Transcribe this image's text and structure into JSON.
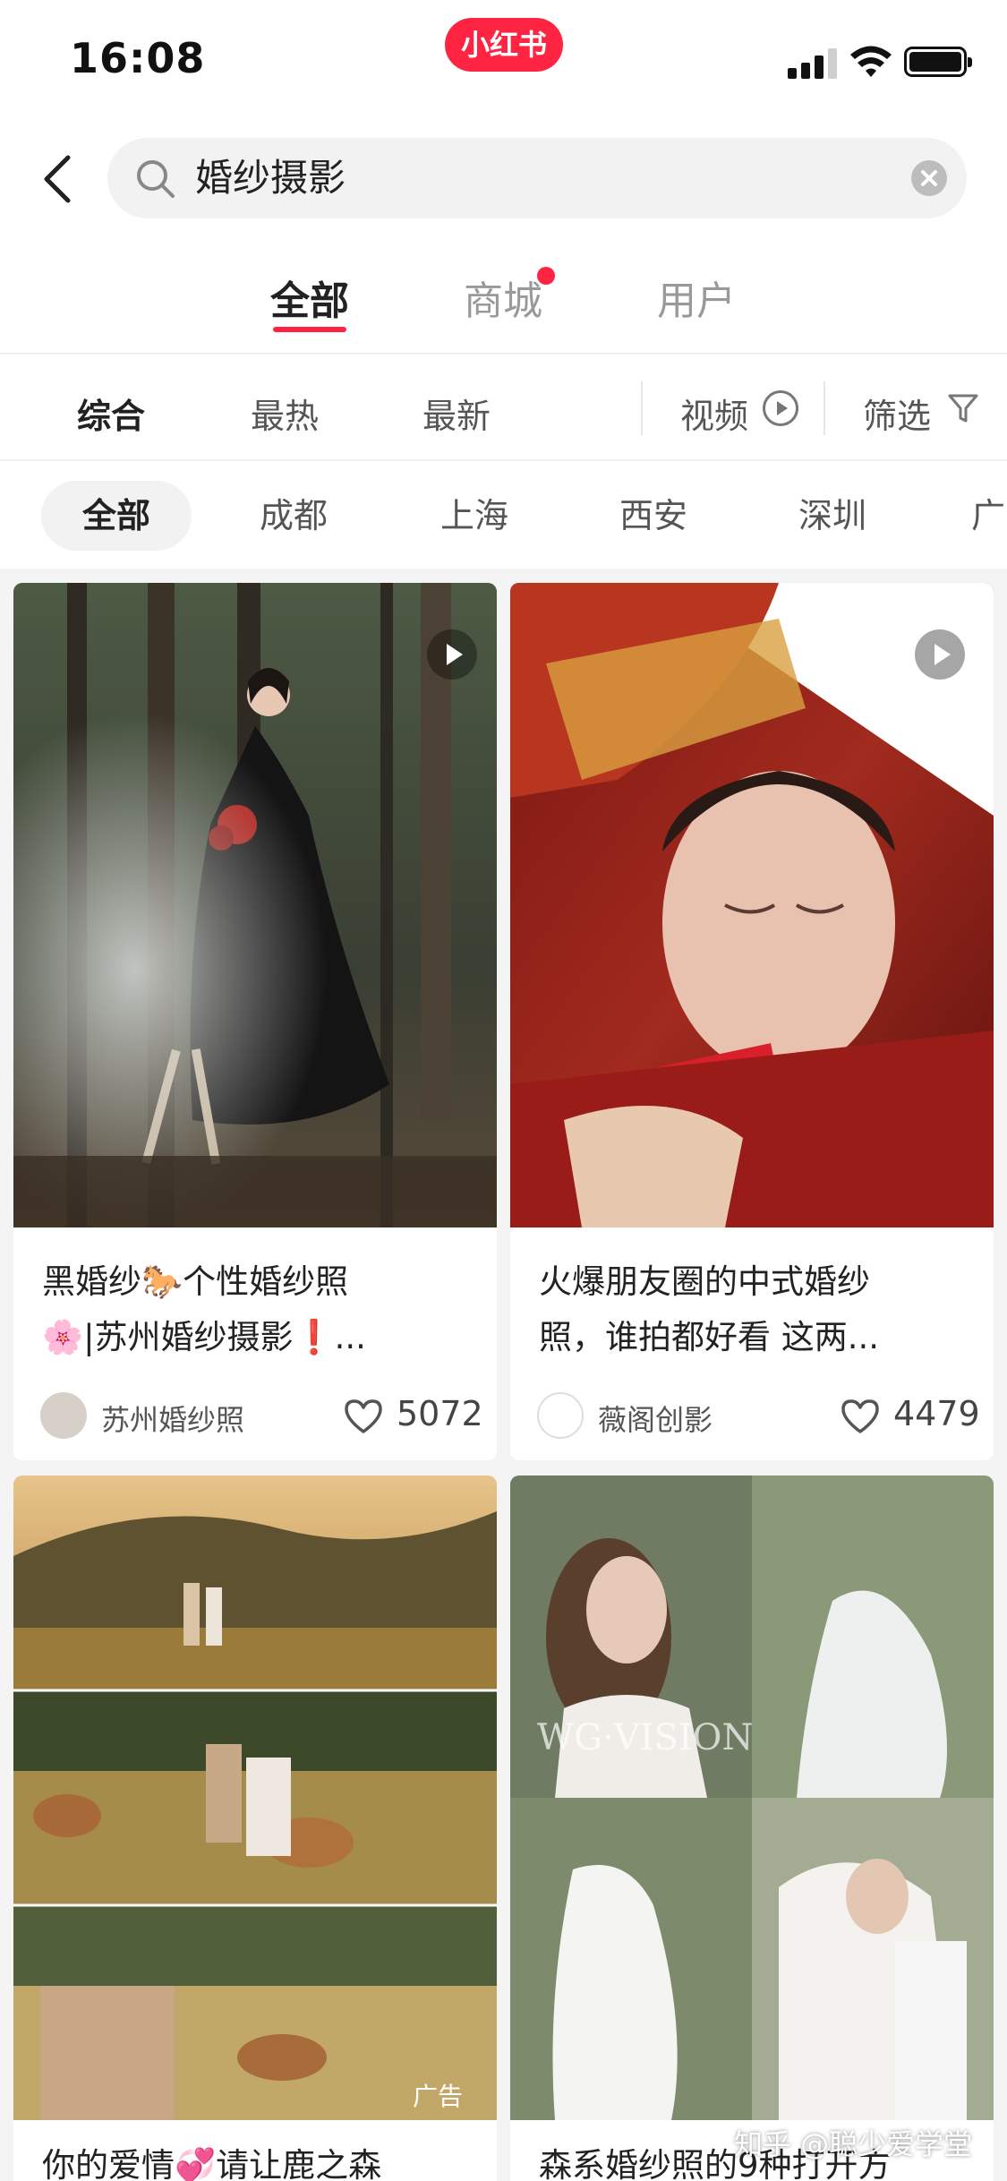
{
  "status_bar": {
    "time": "16:08",
    "app_badge": "小红书"
  },
  "search": {
    "back_icon": "chevron-left-icon",
    "query": "婚纱摄影",
    "search_icon": "search-icon",
    "clear_icon": "clear-icon"
  },
  "main_tabs": [
    {
      "label": "全部",
      "active": true
    },
    {
      "label": "商城",
      "has_dot": true
    },
    {
      "label": "用户"
    }
  ],
  "sort_row": {
    "options": [
      "综合",
      "最热",
      "最新"
    ],
    "active": "综合",
    "video_label": "视频",
    "filter_label": "筛选"
  },
  "city_chips": [
    "全部",
    "成都",
    "上海",
    "西安",
    "深圳",
    "广"
  ],
  "cards": [
    {
      "title": "黑婚纱🐎个性婚纱照🌸|苏州婚纱摄影❗...",
      "title_line1": "黑婚纱🐎个性婚纱照",
      "title_line2": "🌸|苏州婚纱摄影❗...",
      "author": "苏州婚纱照",
      "likes": "5072",
      "is_video": true
    },
    {
      "title_line1": "火爆朋友圈的中式婚纱",
      "title_line2": "照，谁拍都好看 这两...",
      "author": "薇阁创影",
      "likes": "4479",
      "is_video": true
    },
    {
      "title_line1": "你的爱情💞请让鹿之森",
      "ad_label": "广告"
    },
    {
      "title_line1": "森系婚纱照的9种打开方",
      "watermark_text": "WG·VISION"
    }
  ],
  "watermark": "知乎 @聪少爱学堂",
  "colors": {
    "accent": "#ff2442",
    "chip_bg": "#f2f2f2"
  }
}
